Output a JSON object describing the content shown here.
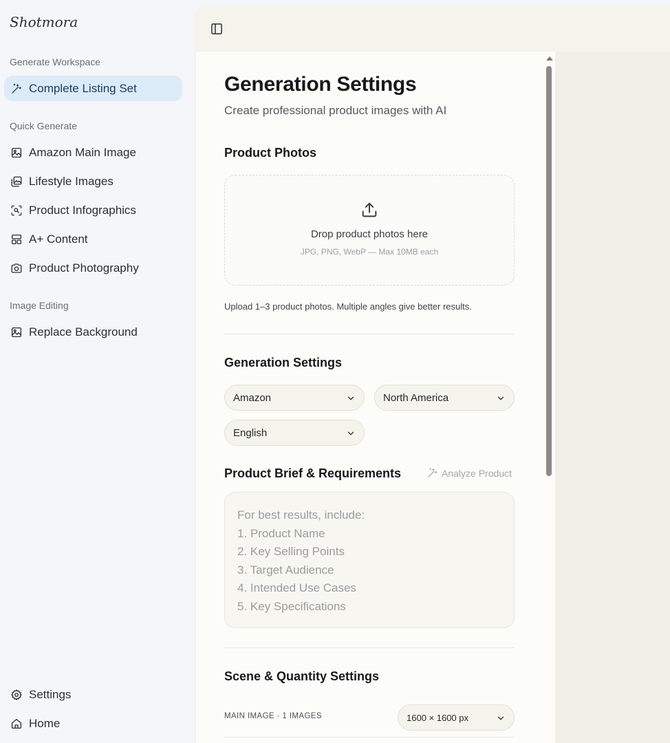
{
  "sidebar": {
    "brand": "Shotmora",
    "sections": {
      "generate": "Generate Workspace",
      "quick": "Quick Generate",
      "editing": "Image Editing"
    },
    "items": {
      "complete_listing": "Complete Listing Set",
      "amazon_main": "Amazon Main Image",
      "lifestyle": "Lifestyle Images",
      "infographics": "Product Infographics",
      "aplus": "A+ Content",
      "photography": "Product Photography",
      "replace_bg": "Replace Background",
      "settings": "Settings",
      "home": "Home"
    }
  },
  "main": {
    "title": "Generation Settings",
    "subtitle": "Create professional product images with AI",
    "photos": {
      "heading": "Product Photos",
      "drop_title": "Drop product photos here",
      "drop_sub": "JPG, PNG, WebP — Max 10MB each",
      "hint": "Upload 1–3 product photos. Multiple angles give better results."
    },
    "generation": {
      "heading": "Generation Settings",
      "platform": "Amazon",
      "region": "North America",
      "language": "English"
    },
    "brief": {
      "heading": "Product Brief & Requirements",
      "analyze": "Analyze Product",
      "placeholder_lines": [
        "For best results, include:",
        "1. Product Name",
        "2. Key Selling Points",
        "3. Target Audience",
        "4. Intended Use Cases",
        "5. Key Specifications"
      ]
    },
    "scene": {
      "heading": "Scene & Quantity Settings",
      "main_image_label": "MAIN IMAGE · 1 IMAGES",
      "main_image_size": "1600 × 1600 px"
    }
  },
  "colors": {
    "active_bg": "#dcebf8",
    "active_text": "#1a3d66",
    "panel_bg": "#fcfcf8"
  }
}
